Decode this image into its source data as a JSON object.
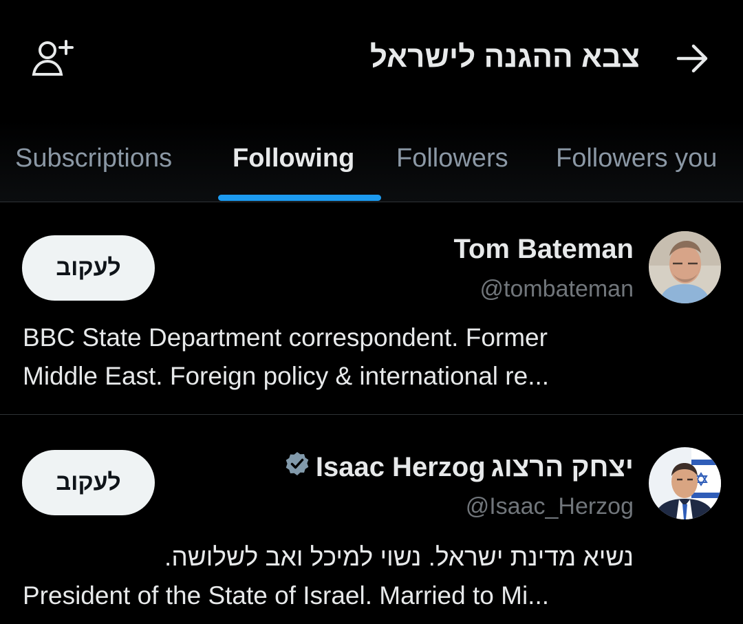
{
  "header": {
    "title": "צבא ההגנה לישראל",
    "back_icon": "arrow-right-icon",
    "add_icon": "person-plus-icon"
  },
  "tabs": [
    {
      "label": "Subscriptions",
      "active": false
    },
    {
      "label": "Following",
      "active": true
    },
    {
      "label": "Followers",
      "active": false
    },
    {
      "label": "Followers you",
      "active": false
    }
  ],
  "accent_color": "#1d9bf0",
  "users": [
    {
      "name": "Tom Bateman",
      "handle": "@tombateman",
      "verified": false,
      "follow_label": "לעקוב",
      "bio_lines": [
        "BBC State Department correspondent. Former",
        "Middle East. Foreign policy & international re..."
      ]
    },
    {
      "name_hebrew": "יצחק הרצוג",
      "name": "Isaac Herzog",
      "handle": "@Isaac_Herzog",
      "verified": true,
      "follow_label": "לעקוב",
      "bio_hebrew": "נשיא מדינת ישראל. נשוי למיכל ואב לשלושה.",
      "bio_line": "President of the State of Israel. Married to Mi..."
    }
  ]
}
